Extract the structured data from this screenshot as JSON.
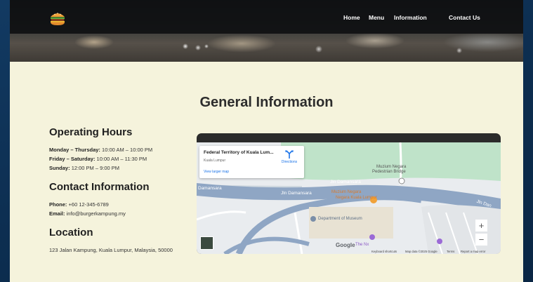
{
  "nav": {
    "logo_icon": "burger-icon",
    "links": [
      "Home",
      "Menu",
      "Information",
      "Contact Us"
    ]
  },
  "page": {
    "title": "General Information"
  },
  "operating_hours": {
    "heading": "Operating Hours",
    "rows": [
      {
        "label": "Monday – Thursday:",
        "value": "10:00 AM – 10:00 PM"
      },
      {
        "label": "Friday – Saturday:",
        "value": "10:00 AM – 11:30 PM"
      },
      {
        "label": "Sunday:",
        "value": "12:00 PM – 9:00 PM"
      }
    ]
  },
  "contact": {
    "heading": "Contact Information",
    "phone_label": "Phone:",
    "phone": "+60 12-345-6789",
    "email_label": "Email:",
    "email": "info@burgerkampung.my"
  },
  "location": {
    "heading": "Location",
    "address": "123 Jalan Kampung, Kuala Lumpur, Malaysia, 50000"
  },
  "map": {
    "place_name": "Federal Territory of Kuala Lum...",
    "place_sub": "Kuala Lumpur",
    "directions": "Directions",
    "larger_map": "View larger map",
    "labels": {
      "museum_bridge_1": "Muzium Negara",
      "museum_bridge_2": "Pedestrian Bridge",
      "road_a": "Jln Damansara",
      "road_b": "Jln Damansara",
      "road_c": "Damansara",
      "road_d": "Jln Dan",
      "poi_1": "Muzium Negara",
      "poi_2": "Negara Kuala Lumpur",
      "dept_museum": "Department of Museum",
      "the_nx": "The Nx"
    },
    "google": "Google",
    "attribution": [
      "Keyboard shortcuts",
      "Map data ©2025 Google",
      "Terms",
      "Report a map error"
    ],
    "zoom_in": "+",
    "zoom_out": "−"
  },
  "colors": {
    "page_bg": "#f5f3dc",
    "nav_bg": "#0c0e10",
    "road": "#8fa6c4",
    "park": "#b9dfc3"
  }
}
